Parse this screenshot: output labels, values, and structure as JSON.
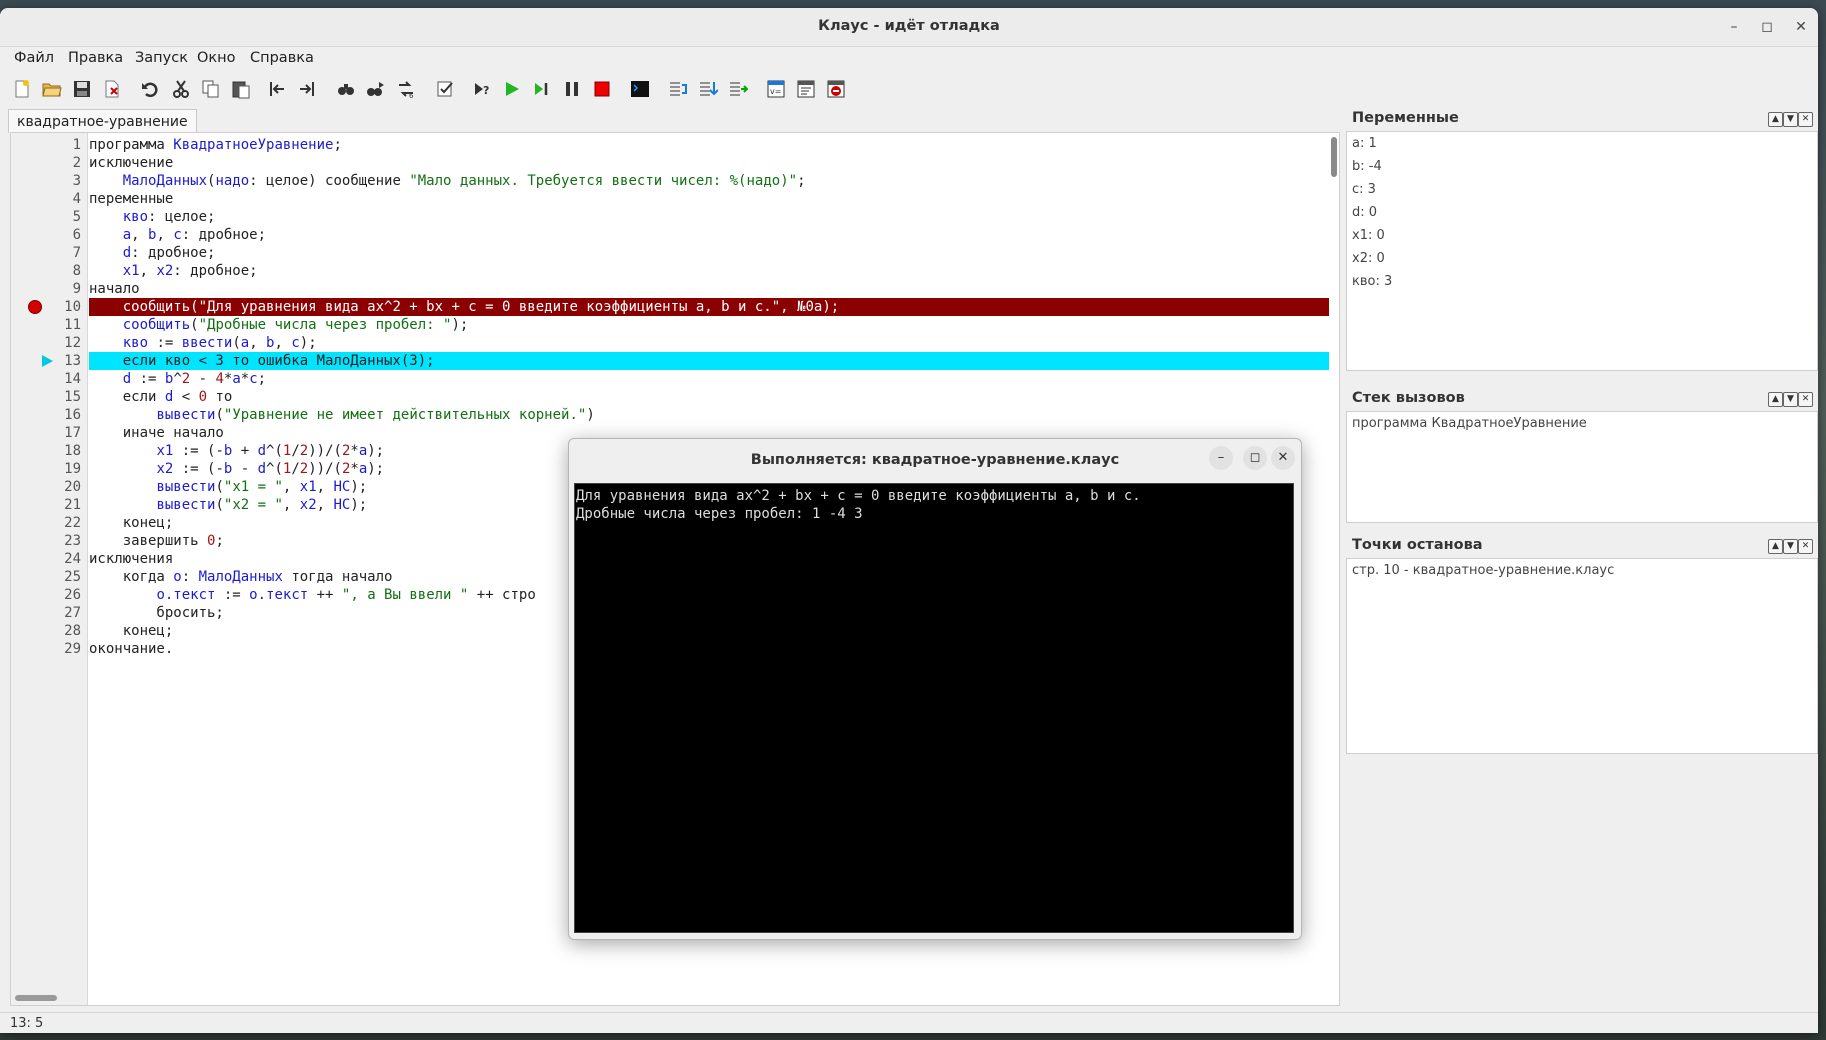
{
  "window": {
    "title": "Клаус - идёт отладка"
  },
  "menu": [
    "Файл",
    "Правка",
    "Запуск",
    "Окно",
    "Справка"
  ],
  "tab": {
    "label": "квадратное-уравнение"
  },
  "code": [
    {
      "n": "1",
      "segs": [
        [
          "kw",
          "программа "
        ],
        [
          "id",
          "КвадратноеУравнение"
        ],
        [
          "kw",
          ";"
        ]
      ]
    },
    {
      "n": "2",
      "segs": [
        [
          "kw",
          "исключение"
        ]
      ]
    },
    {
      "n": "3",
      "segs": [
        [
          "kw",
          "    "
        ],
        [
          "id",
          "МалоДанных"
        ],
        [
          "kw",
          "("
        ],
        [
          "id",
          "надо"
        ],
        [
          "kw",
          ": целое) сообщение "
        ],
        [
          "str",
          "\"Мало данных. Требуется ввести чисел: %(надо)\""
        ],
        [
          "kw",
          ";"
        ]
      ]
    },
    {
      "n": "4",
      "segs": [
        [
          "kw",
          "переменные"
        ]
      ]
    },
    {
      "n": "5",
      "segs": [
        [
          "kw",
          "    "
        ],
        [
          "id",
          "кво"
        ],
        [
          "kw",
          ": целое;"
        ]
      ]
    },
    {
      "n": "6",
      "segs": [
        [
          "kw",
          "    "
        ],
        [
          "id",
          "a"
        ],
        [
          "kw",
          ", "
        ],
        [
          "id",
          "b"
        ],
        [
          "kw",
          ", "
        ],
        [
          "id",
          "c"
        ],
        [
          "kw",
          ": дробное;"
        ]
      ]
    },
    {
      "n": "7",
      "segs": [
        [
          "kw",
          "    "
        ],
        [
          "id",
          "d"
        ],
        [
          "kw",
          ": дробное;"
        ]
      ]
    },
    {
      "n": "8",
      "segs": [
        [
          "kw",
          "    "
        ],
        [
          "id",
          "x1"
        ],
        [
          "kw",
          ", "
        ],
        [
          "id",
          "x2"
        ],
        [
          "kw",
          ": дробное;"
        ]
      ]
    },
    {
      "n": "9",
      "segs": [
        [
          "kw",
          "начало"
        ]
      ]
    },
    {
      "n": "10",
      "segs": [
        [
          "kw",
          "    сообщить("
        ],
        [
          "str",
          "\"Для уравнения вида ax^2 + bx + c = 0 введите коэффициенты a, b и c.\""
        ],
        [
          "kw",
          ", №0a);"
        ]
      ]
    },
    {
      "n": "11",
      "segs": [
        [
          "kw",
          "    "
        ],
        [
          "id",
          "сообщить"
        ],
        [
          "kw",
          "("
        ],
        [
          "str",
          "\"Дробные числа через пробел: \""
        ],
        [
          "kw",
          ");"
        ]
      ]
    },
    {
      "n": "12",
      "segs": [
        [
          "kw",
          "    "
        ],
        [
          "id",
          "кво"
        ],
        [
          "kw",
          " := "
        ],
        [
          "id",
          "ввести"
        ],
        [
          "kw",
          "("
        ],
        [
          "id",
          "a"
        ],
        [
          "kw",
          ", "
        ],
        [
          "id",
          "b"
        ],
        [
          "kw",
          ", "
        ],
        [
          "id",
          "c"
        ],
        [
          "kw",
          ");"
        ]
      ]
    },
    {
      "n": "13",
      "segs": [
        [
          "kw",
          "    если кво < 3 то ошибка МалоДанных(3);"
        ]
      ]
    },
    {
      "n": "14",
      "segs": [
        [
          "kw",
          "    "
        ],
        [
          "id",
          "d"
        ],
        [
          "kw",
          " := "
        ],
        [
          "id",
          "b"
        ],
        [
          "kw",
          "^"
        ],
        [
          "num",
          "2"
        ],
        [
          "kw",
          " - "
        ],
        [
          "num",
          "4"
        ],
        [
          "kw",
          "*"
        ],
        [
          "id",
          "a"
        ],
        [
          "kw",
          "*"
        ],
        [
          "id",
          "c"
        ],
        [
          "kw",
          ";"
        ]
      ]
    },
    {
      "n": "15",
      "segs": [
        [
          "kw",
          "    если "
        ],
        [
          "id",
          "d"
        ],
        [
          "kw",
          " < "
        ],
        [
          "num",
          "0"
        ],
        [
          "kw",
          " то"
        ]
      ]
    },
    {
      "n": "16",
      "segs": [
        [
          "kw",
          "        "
        ],
        [
          "id",
          "вывести"
        ],
        [
          "kw",
          "("
        ],
        [
          "str",
          "\"Уравнение не имеет действительных корней.\""
        ],
        [
          "kw",
          ")"
        ]
      ]
    },
    {
      "n": "17",
      "segs": [
        [
          "kw",
          "    иначе начало"
        ]
      ]
    },
    {
      "n": "18",
      "segs": [
        [
          "kw",
          "        "
        ],
        [
          "id",
          "x1"
        ],
        [
          "kw",
          " := (-"
        ],
        [
          "id",
          "b"
        ],
        [
          "kw",
          " + "
        ],
        [
          "id",
          "d"
        ],
        [
          "kw",
          "^("
        ],
        [
          "num",
          "1"
        ],
        [
          "kw",
          "/"
        ],
        [
          "num",
          "2"
        ],
        [
          "kw",
          "))/("
        ],
        [
          "num",
          "2"
        ],
        [
          "kw",
          "*"
        ],
        [
          "id",
          "a"
        ],
        [
          "kw",
          ");"
        ]
      ]
    },
    {
      "n": "19",
      "segs": [
        [
          "kw",
          "        "
        ],
        [
          "id",
          "x2"
        ],
        [
          "kw",
          " := (-"
        ],
        [
          "id",
          "b"
        ],
        [
          "kw",
          " - "
        ],
        [
          "id",
          "d"
        ],
        [
          "kw",
          "^("
        ],
        [
          "num",
          "1"
        ],
        [
          "kw",
          "/"
        ],
        [
          "num",
          "2"
        ],
        [
          "kw",
          "))/("
        ],
        [
          "num",
          "2"
        ],
        [
          "kw",
          "*"
        ],
        [
          "id",
          "a"
        ],
        [
          "kw",
          ");"
        ]
      ]
    },
    {
      "n": "20",
      "segs": [
        [
          "kw",
          "        "
        ],
        [
          "id",
          "вывести"
        ],
        [
          "kw",
          "("
        ],
        [
          "str",
          "\"x1 = \""
        ],
        [
          "kw",
          ", "
        ],
        [
          "id",
          "x1"
        ],
        [
          "kw",
          ", "
        ],
        [
          "id",
          "НС"
        ],
        [
          "kw",
          ");"
        ]
      ]
    },
    {
      "n": "21",
      "segs": [
        [
          "kw",
          "        "
        ],
        [
          "id",
          "вывести"
        ],
        [
          "kw",
          "("
        ],
        [
          "str",
          "\"x2 = \""
        ],
        [
          "kw",
          ", "
        ],
        [
          "id",
          "x2"
        ],
        [
          "kw",
          ", "
        ],
        [
          "id",
          "НС"
        ],
        [
          "kw",
          ");"
        ]
      ]
    },
    {
      "n": "22",
      "segs": [
        [
          "kw",
          "    конец;"
        ]
      ]
    },
    {
      "n": "23",
      "segs": [
        [
          "kw",
          "    завершить "
        ],
        [
          "num",
          "0"
        ],
        [
          "kw",
          ";"
        ]
      ]
    },
    {
      "n": "24",
      "segs": [
        [
          "kw",
          "исключения"
        ]
      ]
    },
    {
      "n": "25",
      "segs": [
        [
          "kw",
          "    когда "
        ],
        [
          "id",
          "о"
        ],
        [
          "kw",
          ": "
        ],
        [
          "id",
          "МалоДанных"
        ],
        [
          "kw",
          " тогда начало"
        ]
      ]
    },
    {
      "n": "26",
      "segs": [
        [
          "kw",
          "        "
        ],
        [
          "id",
          "о.текст"
        ],
        [
          "kw",
          " := "
        ],
        [
          "id",
          "о.текст"
        ],
        [
          "kw",
          " ++ "
        ],
        [
          "str",
          "\", а Вы ввели \""
        ],
        [
          "kw",
          " ++ стро"
        ]
      ]
    },
    {
      "n": "27",
      "segs": [
        [
          "kw",
          "        бросить;"
        ]
      ]
    },
    {
      "n": "28",
      "segs": [
        [
          "kw",
          "    конец;"
        ]
      ]
    },
    {
      "n": "29",
      "segs": [
        [
          "kw",
          "окончание."
        ]
      ]
    }
  ],
  "editor": {
    "breakpoint_line": 10,
    "current_line": 13
  },
  "status": {
    "position": "13: 5"
  },
  "panels": {
    "variables": {
      "title": "Переменные",
      "items": [
        "a: 1",
        "b: -4",
        "c: 3",
        "d: 0",
        "x1: 0",
        "x2: 0",
        "кво: 3"
      ]
    },
    "callstack": {
      "title": "Стек вызовов",
      "items": [
        "программа КвадратноеУравнение"
      ]
    },
    "breakpoints": {
      "title": "Точки останова",
      "items": [
        "стр. 10 - квадратное-уравнение.клаус"
      ]
    }
  },
  "console": {
    "title": "Выполняется: квадратное-уравнение.клаус",
    "lines": [
      "Для уравнения вида ax^2 + bx + c = 0 введите коэффициенты a, b и c.",
      "Дробные числа через пробел: 1 -4 3"
    ]
  },
  "toolbar_icons": [
    "new-file-icon",
    "open-folder-icon",
    "save-icon",
    "close-file-icon",
    "undo-icon",
    "cut-icon",
    "copy-icon",
    "paste-icon",
    "prev-icon",
    "next-icon",
    "find-icon",
    "find-next-icon",
    "replace-icon",
    "check-icon",
    "run-debug-icon",
    "run-icon",
    "step-icon",
    "pause-icon",
    "stop-icon",
    "terminal-icon",
    "step-into-icon",
    "step-over-icon",
    "step-out-icon",
    "variables-icon",
    "callstack-icon",
    "breakpoints-icon"
  ]
}
